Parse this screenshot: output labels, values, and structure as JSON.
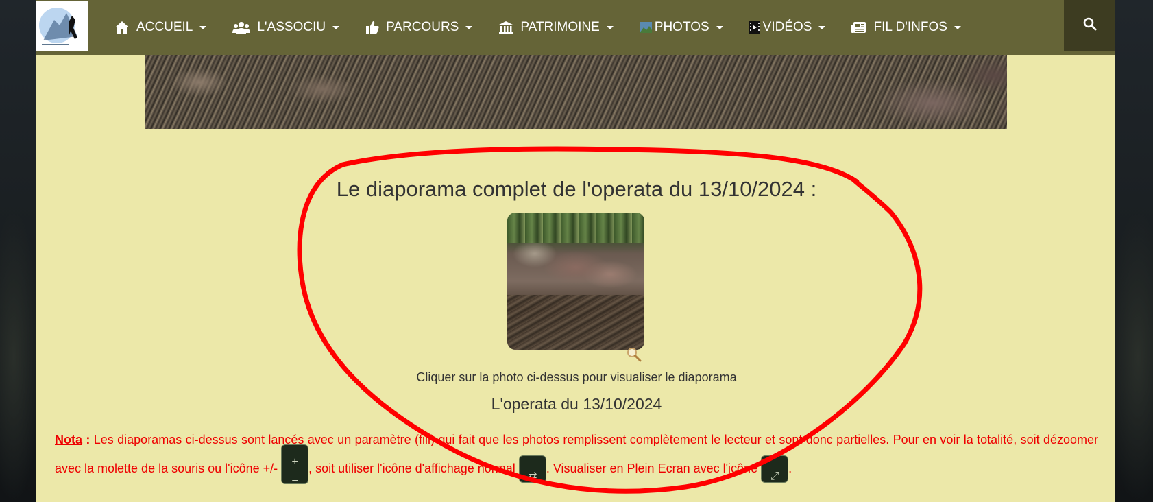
{
  "nav": {
    "items": [
      {
        "label": "ACCUEIL",
        "icon": "home-icon"
      },
      {
        "label": "L'ASSOCIU",
        "icon": "users-icon"
      },
      {
        "label": "PARCOURS",
        "icon": "thumbs-up-icon"
      },
      {
        "label": "PATRIMOINE",
        "icon": "bank-icon"
      },
      {
        "label": "PHOTOS",
        "icon": "photo-icon"
      },
      {
        "label": "VIDÉOS",
        "icon": "film-icon"
      },
      {
        "label": "FIL D'INFOS",
        "icon": "newspaper-icon"
      }
    ],
    "search_icon": "search-icon"
  },
  "main": {
    "title": "Le diaporama complet de l'operata du 13/10/2024 :",
    "caption": "Cliquer sur la photo ci-dessus pour visualiser le diaporama",
    "subtitle": "L'operata du 13/10/2024",
    "nota": {
      "label": "Nota",
      "colon": " :",
      "text1": " Les diaporamas ci-dessus sont lancés avec un paramètre (fill) qui fait que les photos remplissent complètement le lecteur et sont donc partielles. Pour en voir la totalité, soit dézoomer avec la molette de la souris ou l'icône +/- ",
      "text2": ", soit utiliser l'icône d'affichage normal ",
      "text3": ". Visualiser en Plein Ecran avec l'icône ",
      "text4": "."
    }
  },
  "colors": {
    "navbar": "#656437",
    "page_bg": "#ece8a9",
    "nota_red": "#ee0000",
    "annotation_red": "#ff0000"
  }
}
